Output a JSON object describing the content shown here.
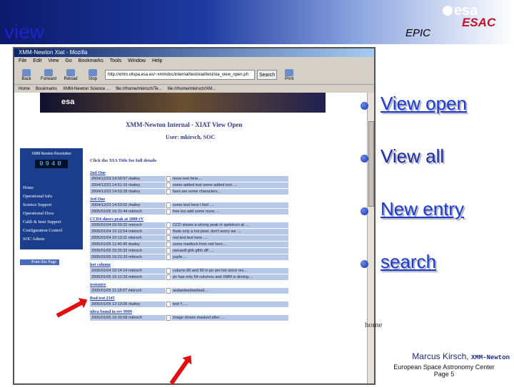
{
  "slide": {
    "title": "view",
    "epic": "EPIC",
    "logo": "esa",
    "logo_sub": "ESAC",
    "home": "home"
  },
  "bullets": [
    {
      "label": "View open",
      "link": true
    },
    {
      "label": "View all",
      "link": false
    },
    {
      "label": "New entry",
      "link": true
    },
    {
      "label": "search",
      "link": true
    }
  ],
  "footer": {
    "author": "Marcus Kirsch,",
    "project": "XMM-Newton",
    "org": "European Space Astronomy Center",
    "page": "Page 5"
  },
  "browser": {
    "title": "XMM-Newton Xiat - Mozilla",
    "menu": [
      "File",
      "Edit",
      "View",
      "Go",
      "Bookmarks",
      "Tools",
      "Window",
      "Help"
    ],
    "toolbar": [
      "Back",
      "Forward",
      "Reload",
      "Stop"
    ],
    "url": "http://xmm.vilspa.esa.es/~xmmdoc/internal/test/xiat/test/xia_view_open.ph",
    "search_label": "Search",
    "print_label": "Print",
    "bookmarks": [
      "Home",
      "Bookmarks",
      "XMM-Newton Science ...",
      "file:///home/mkirsch/Te...",
      "file:///home/mkirsch/XM..."
    ],
    "page_title": "XMM-Newton Internal - XIAT View Open",
    "user": "User: mkirsch, SOC",
    "rev_label": "XMM-Newton Revolution",
    "rev": "0940",
    "nav": [
      "Home",
      "Operational Info",
      "Science Support",
      "Operational Docs",
      "Calib & Instr Support",
      "Configuration Control",
      "SOC Admin"
    ],
    "print_page": "Print this Page",
    "click_info": "Click the XIA Title for full details",
    "sections": [
      {
        "title": "2nd One",
        "rows": [
          [
            "2004/12/23 14:50:57 rbailey",
            "more text here...."
          ],
          [
            "2004/12/23 14:51:16 rbailey",
            "some added text some added text ...."
          ],
          [
            "2004/12/23 14:53:28 rbailey",
            "here are some characters...."
          ]
        ]
      },
      {
        "title": "3rd One",
        "rows": [
          [
            "2004/12/23 14:53:52 rbailey",
            "some text here I feel ...."
          ],
          [
            "2005/01/05 16:31:44 mkirsch",
            "free too add some more...."
          ]
        ]
      },
      {
        "title": "CCD4 shows peak at 1000 eV",
        "rows": [
          [
            "2005/01/04 09:59:32 mkirsch",
            "CCD shows a strong peak in spektrum at ...."
          ],
          [
            "2005/01/04 10:12:54 mkirsch",
            "thats only a hot pixel, don't worry we ...."
          ],
          [
            "2005/01/04 10:13:11 mkirsch",
            "red text text here ...."
          ],
          [
            "2005/01/05 11:40:49 rbailey",
            "some madlock from red here...."
          ],
          [
            "2005/01/05 15:20:32 mkirsch",
            "owrasdf ghh gfhh dff ...."
          ],
          [
            "2005/01/05 15:21:33 mkirsch",
            "yuyfe...."
          ]
        ]
      },
      {
        "title": "hot column",
        "rows": [
          [
            "2005/01/04 10:14:14 mkirsch",
            "column 80 and 90 in pn are hot since rev...."
          ],
          [
            "2005/01/05 15:12:33 mkirsch",
            "pn has only 64 columns and XMM is driving...."
          ]
        ]
      },
      {
        "title": "testentry",
        "rows": [
          [
            "2005/01/05 11:18:07 mkirsch",
            "asdasdasdasdasd...."
          ]
        ]
      },
      {
        "title": "Rod test 2345",
        "rows": [
          [
            "2005/01/05 12:13:06 rbailey",
            "test !!....."
          ]
        ]
      },
      {
        "title": "ultra found in rev 9999",
        "rows": [
          [
            "2005/01/05 16:33:58 mkirsch",
            "image shows masked after ...."
          ]
        ]
      }
    ]
  }
}
